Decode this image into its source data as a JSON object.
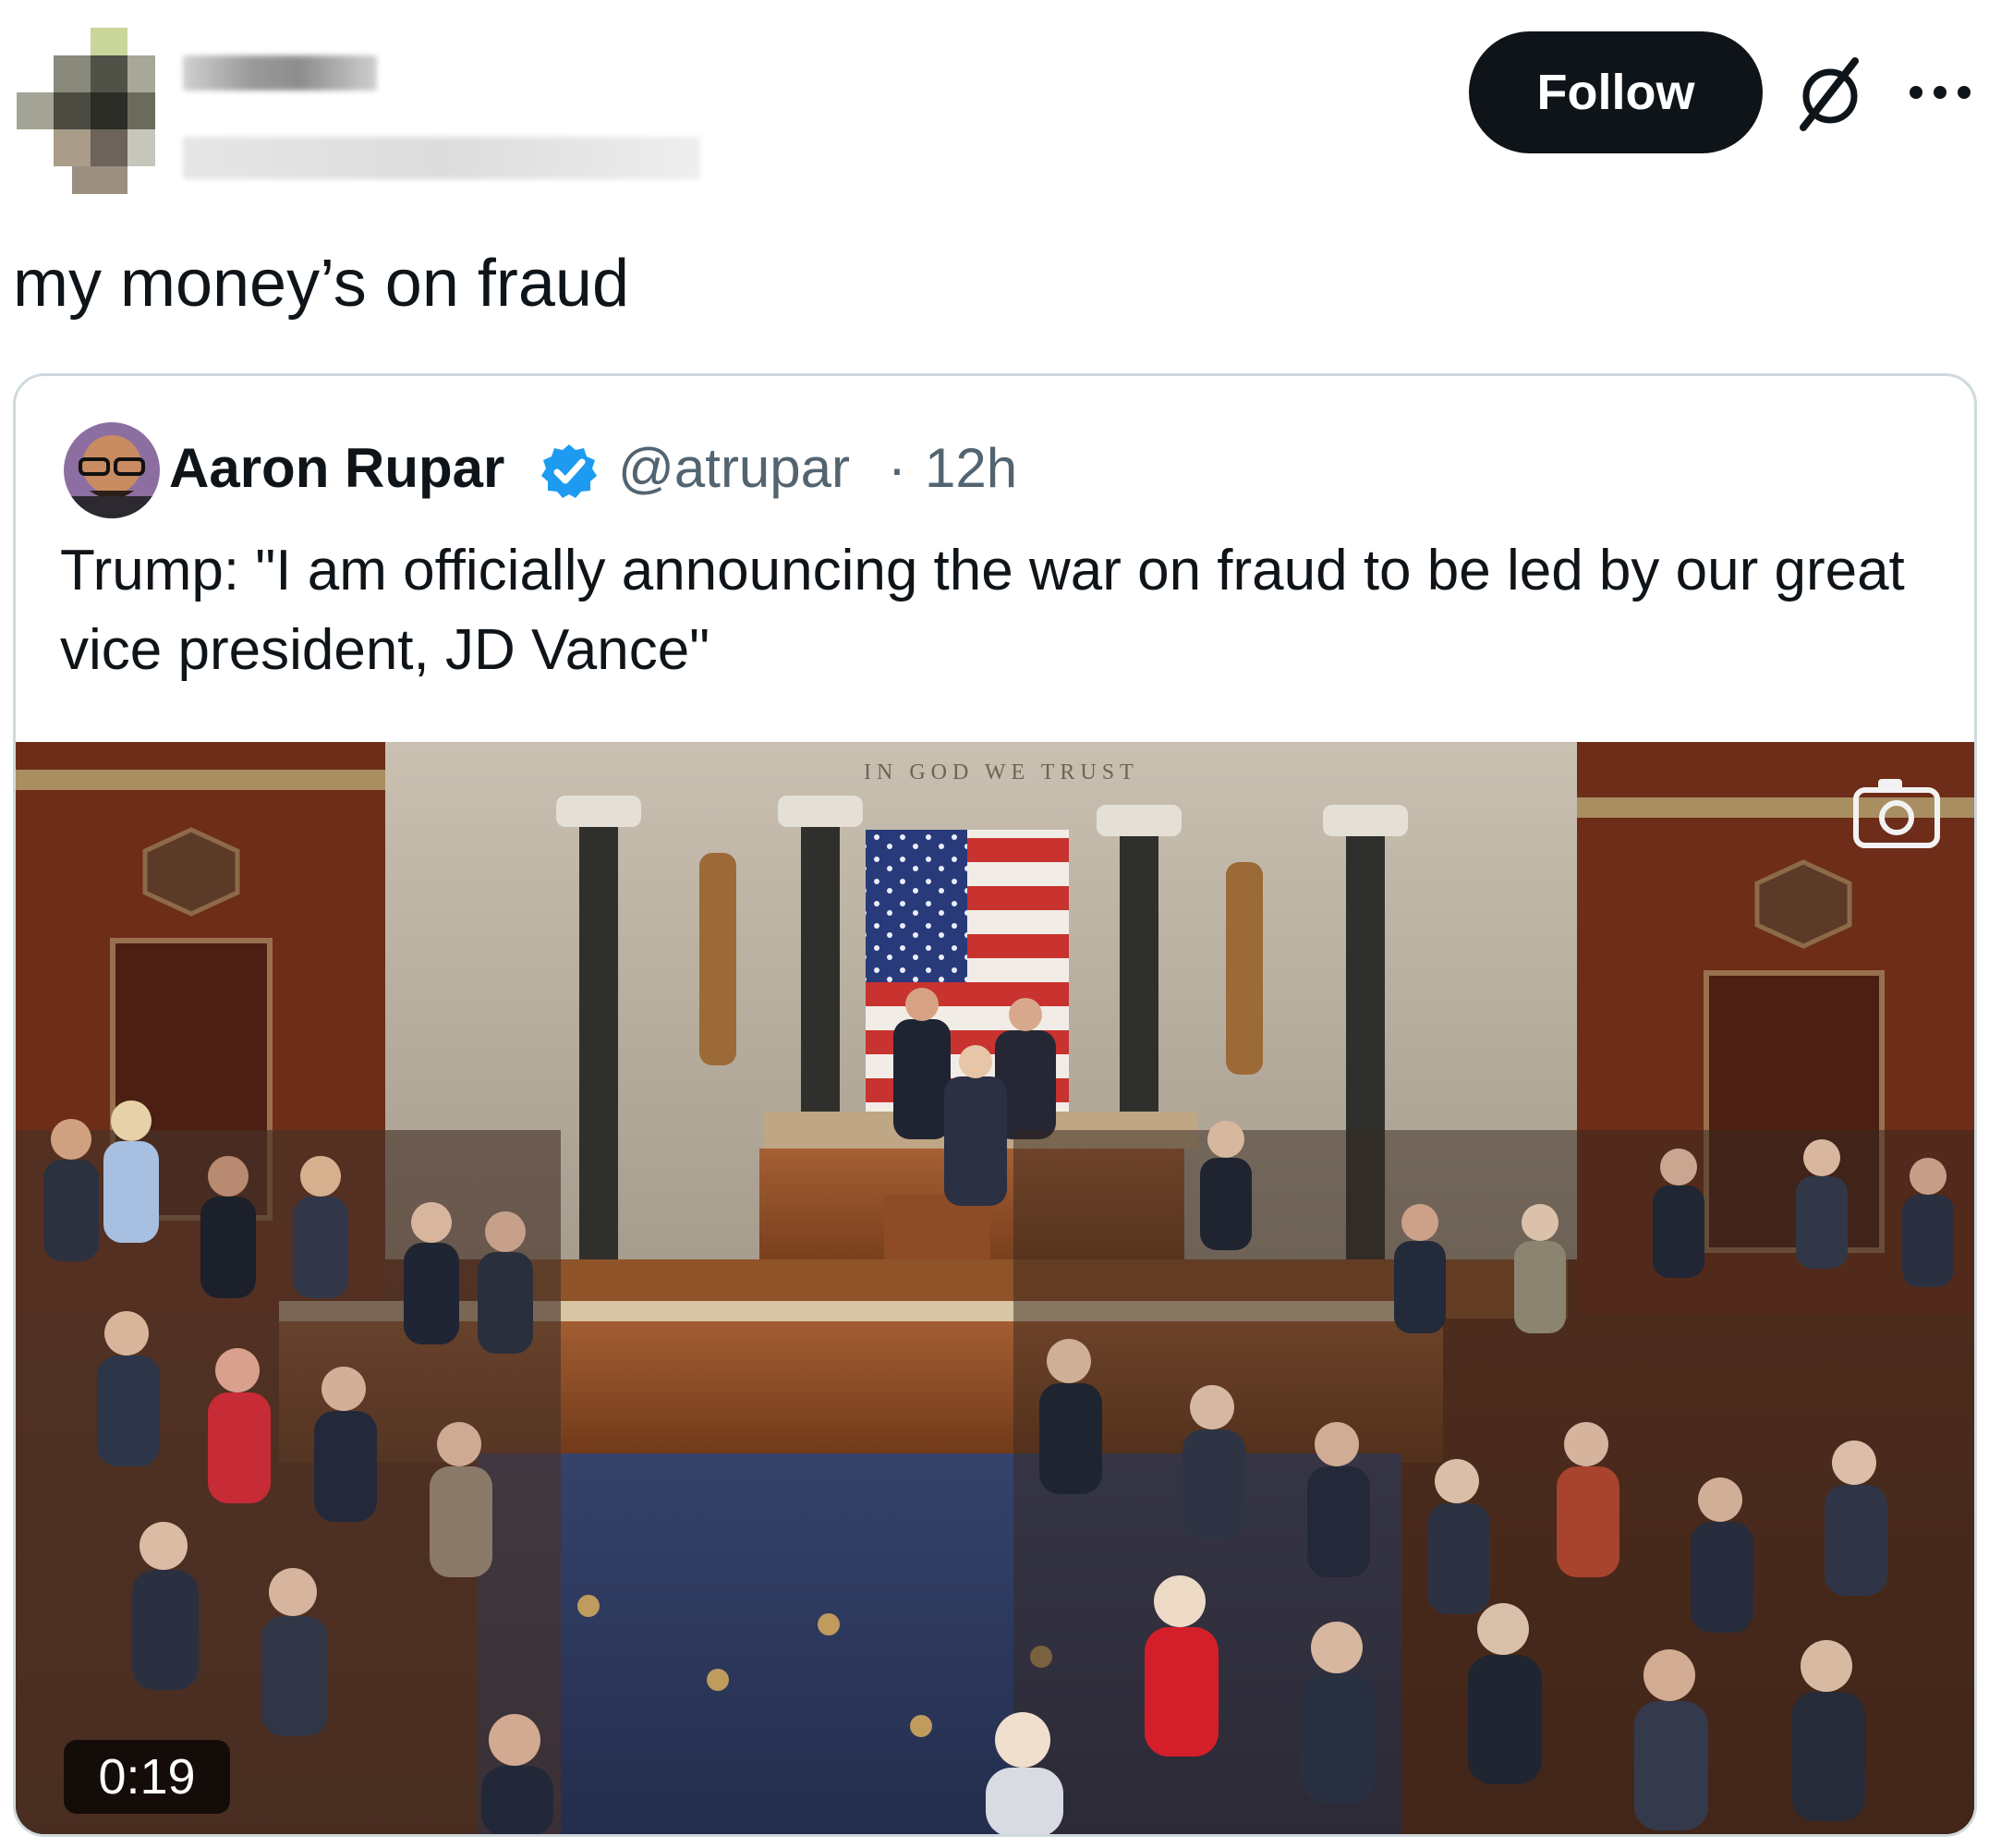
{
  "author": {
    "name": "",
    "handle": "",
    "avatar": "pixelated-avatar"
  },
  "actions": {
    "follow_label": "Follow",
    "grok_icon": "slashed-circle-icon",
    "more_icon": "more-dots-icon"
  },
  "tweet": {
    "text": "my money’s on fraud"
  },
  "quote": {
    "author_name": "Aaron Rupar",
    "verified_icon": "verified-badge-icon",
    "handle": "@atrupar",
    "separator": "·",
    "time": "12h",
    "text": "Trump: \"I am officially announcing the war on fraud to be led by our great vice president, JD Vance\"",
    "media": {
      "duration": "0:19",
      "overlay_icon": "camera-icon",
      "scene_motto": "IN GOD WE TRUST"
    }
  },
  "colors": {
    "follow_button_bg": "#0f1419",
    "follow_button_text": "#ffffff",
    "secondary_text": "#536471",
    "verified_blue": "#1d9bf0",
    "card_border": "#cfd9de"
  }
}
